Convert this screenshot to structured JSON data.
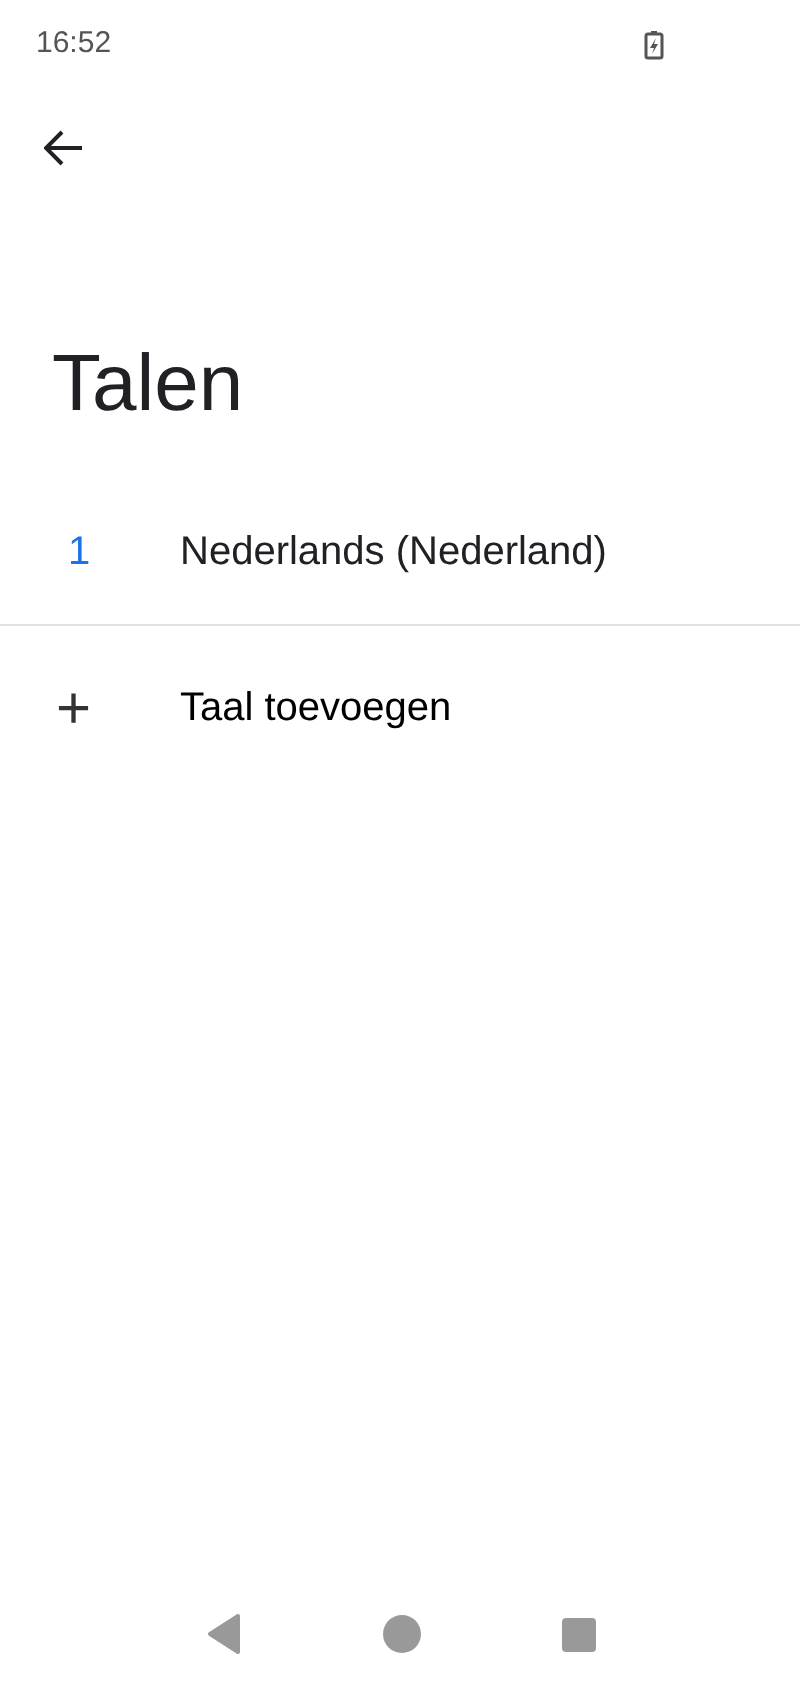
{
  "status_bar": {
    "time": "16:52"
  },
  "title": "Talen",
  "languages": [
    {
      "number": "1",
      "name": "Nederlands (Nederland)"
    }
  ],
  "add_language": {
    "icon": "+",
    "label": "Taal toevoegen"
  }
}
